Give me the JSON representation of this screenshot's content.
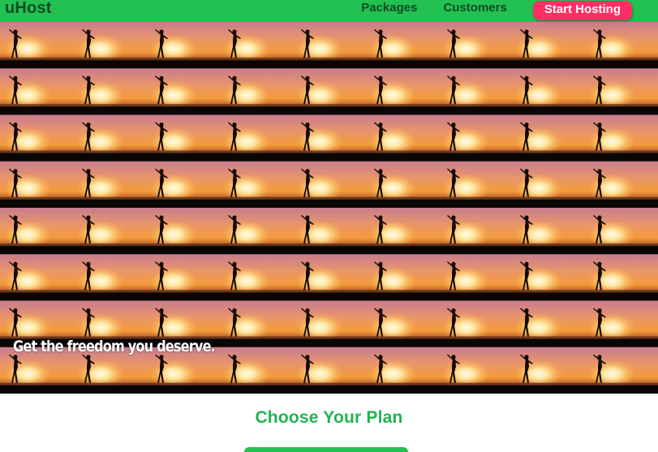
{
  "header": {
    "brand": "uHost",
    "nav": {
      "packages": "Packages",
      "customers": "Customers",
      "cta": "Start Hosting"
    }
  },
  "hero": {
    "tagline": "Get the freedom you deserve."
  },
  "plans": {
    "title": "Choose Your Plan"
  },
  "colors": {
    "header_bg": "#22c152",
    "cta_bg": "#ff2e63",
    "title": "#22b450"
  }
}
